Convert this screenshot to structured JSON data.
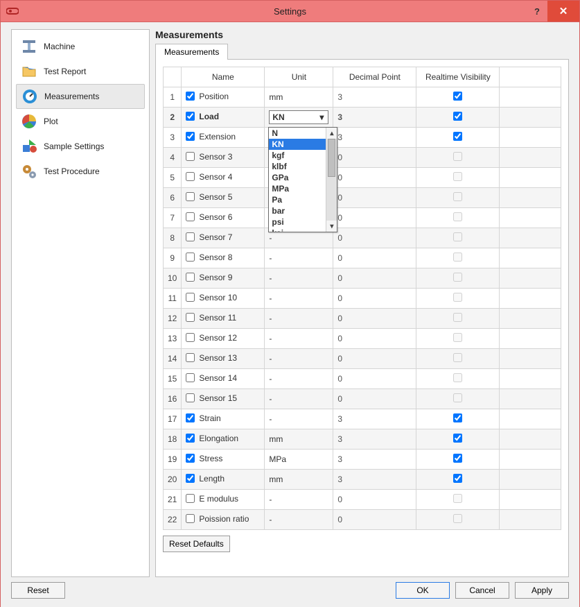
{
  "window": {
    "title": "Settings",
    "help_tooltip": "Help",
    "close_tooltip": "Close"
  },
  "sidebar": {
    "items": [
      {
        "label": "Machine"
      },
      {
        "label": "Test Report"
      },
      {
        "label": "Measurements"
      },
      {
        "label": "Plot"
      },
      {
        "label": "Sample Settings"
      },
      {
        "label": "Test Procedure"
      }
    ]
  },
  "main": {
    "panel_title": "Measurements",
    "tab_label": "Measurements",
    "columns": {
      "name": "Name",
      "unit": "Unit",
      "decimal_point": "Decimal Point",
      "realtime_visibility": "Realtime Visibility"
    },
    "rows": [
      {
        "num": "1",
        "checked": true,
        "name": "Position",
        "unit": "mm",
        "dp": "3",
        "rv": true
      },
      {
        "num": "2",
        "checked": true,
        "name": "Load",
        "unit": "KN",
        "dp": "3",
        "rv": true
      },
      {
        "num": "3",
        "checked": true,
        "name": "Extension",
        "unit": "",
        "dp": "3",
        "rv": true
      },
      {
        "num": "4",
        "checked": false,
        "name": "Sensor 3",
        "unit": "",
        "dp": "0",
        "rv": false
      },
      {
        "num": "5",
        "checked": false,
        "name": "Sensor 4",
        "unit": "",
        "dp": "0",
        "rv": false
      },
      {
        "num": "6",
        "checked": false,
        "name": "Sensor 5",
        "unit": "",
        "dp": "0",
        "rv": false
      },
      {
        "num": "7",
        "checked": false,
        "name": "Sensor 6",
        "unit": "",
        "dp": "0",
        "rv": false
      },
      {
        "num": "8",
        "checked": false,
        "name": "Sensor 7",
        "unit": "-",
        "dp": "0",
        "rv": false
      },
      {
        "num": "9",
        "checked": false,
        "name": "Sensor 8",
        "unit": "-",
        "dp": "0",
        "rv": false
      },
      {
        "num": "10",
        "checked": false,
        "name": "Sensor 9",
        "unit": "-",
        "dp": "0",
        "rv": false
      },
      {
        "num": "11",
        "checked": false,
        "name": "Sensor 10",
        "unit": "-",
        "dp": "0",
        "rv": false
      },
      {
        "num": "12",
        "checked": false,
        "name": "Sensor 11",
        "unit": "-",
        "dp": "0",
        "rv": false
      },
      {
        "num": "13",
        "checked": false,
        "name": "Sensor 12",
        "unit": "-",
        "dp": "0",
        "rv": false
      },
      {
        "num": "14",
        "checked": false,
        "name": "Sensor 13",
        "unit": "-",
        "dp": "0",
        "rv": false
      },
      {
        "num": "15",
        "checked": false,
        "name": "Sensor 14",
        "unit": "-",
        "dp": "0",
        "rv": false
      },
      {
        "num": "16",
        "checked": false,
        "name": "Sensor 15",
        "unit": "-",
        "dp": "0",
        "rv": false
      },
      {
        "num": "17",
        "checked": true,
        "name": "Strain",
        "unit": "-",
        "dp": "3",
        "rv": true
      },
      {
        "num": "18",
        "checked": true,
        "name": "Elongation",
        "unit": "mm",
        "dp": "3",
        "rv": true
      },
      {
        "num": "19",
        "checked": true,
        "name": "Stress",
        "unit": "MPa",
        "dp": "3",
        "rv": true
      },
      {
        "num": "20",
        "checked": true,
        "name": "Length",
        "unit": "mm",
        "dp": "3",
        "rv": true
      },
      {
        "num": "21",
        "checked": false,
        "name": "E modulus",
        "unit": "-",
        "dp": "0",
        "rv": false
      },
      {
        "num": "22",
        "checked": false,
        "name": "Poission ratio",
        "unit": "-",
        "dp": "0",
        "rv": false
      }
    ],
    "unit_dropdown": {
      "options": [
        "N",
        "KN",
        "kgf",
        "klbf",
        "GPa",
        "MPa",
        "Pa",
        "bar",
        "psi",
        "ksi"
      ],
      "selected": "KN"
    },
    "reset_defaults_label": "Reset Defaults"
  },
  "footer": {
    "reset": "Reset",
    "ok": "OK",
    "cancel": "Cancel",
    "apply": "Apply"
  },
  "colors": {
    "titlebar": "#ef7c7c",
    "close": "#e04b3a",
    "accent": "#2a7be4",
    "panel": "#f0f0f0"
  }
}
